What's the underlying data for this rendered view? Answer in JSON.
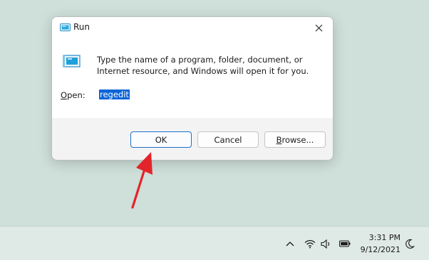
{
  "dialog": {
    "title": "Run",
    "description": "Type the name of a program, folder, document, or Internet resource, and Windows will open it for you.",
    "open_label_prefix": "",
    "open_label_underlined": "O",
    "open_label_rest": "pen:",
    "open_value": "regedit",
    "buttons": {
      "ok": "OK",
      "cancel": "Cancel",
      "browse_underlined": "B",
      "browse_rest": "rowse..."
    }
  },
  "taskbar": {
    "time": "3:31 PM",
    "date": "9/12/2021",
    "tray_icons": [
      "chevron-up-icon",
      "wifi-icon",
      "speaker-icon",
      "battery-icon",
      "moon-icon"
    ]
  },
  "colors": {
    "desktop": "#cfdfd9",
    "accent": "#1f6fc8",
    "selection": "#0a64d8",
    "arrow": "#e3242b"
  }
}
